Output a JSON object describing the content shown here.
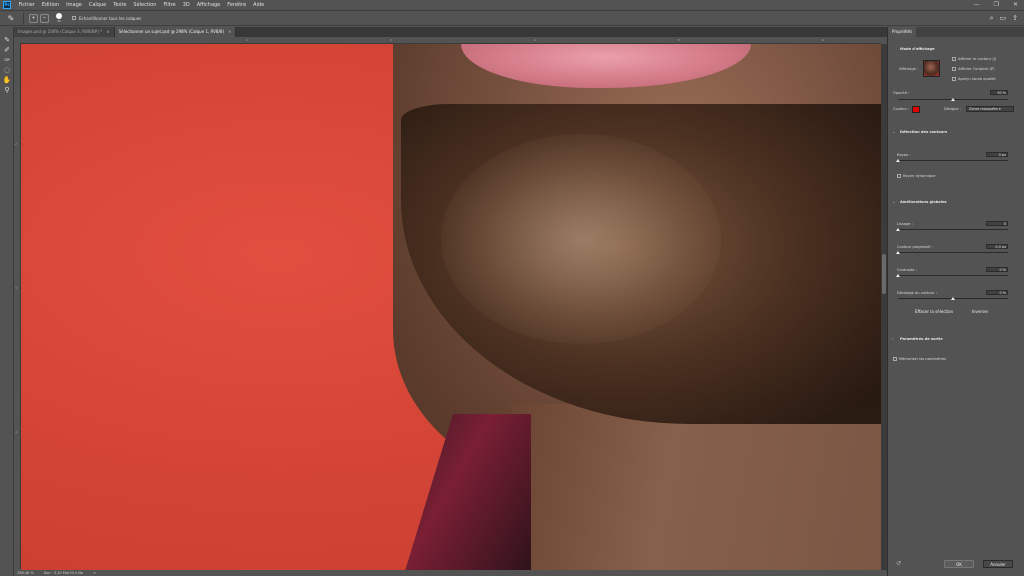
{
  "app": {
    "logo": "Ps"
  },
  "menu": [
    "Fichier",
    "Edition",
    "Image",
    "Calque",
    "Texte",
    "Sélection",
    "Filtre",
    "3D",
    "Affichage",
    "Fenêtre",
    "Aide"
  ],
  "window_controls": {
    "minimize": "—",
    "maximize": "❐",
    "close": "✕"
  },
  "options": {
    "brush_size": "30",
    "sample_all_layers": "Echantillonner tous les calques",
    "right_icons": [
      "search-icon",
      "workspace-icon",
      "share-icon"
    ]
  },
  "tabs": [
    {
      "label": "Images.psd @ 106% (Calque 3, RVB/8#) *",
      "close": "×",
      "active": false
    },
    {
      "label": "Sélectionner un sujet.psd @ 298% (Calque 1, RVB/8)",
      "close": "×",
      "active": true
    }
  ],
  "toolbar": [
    "brush-tool-icon",
    "quick-selection-icon",
    "refine-edge-brush-icon",
    "lasso-icon",
    "hand-icon",
    "zoom-icon"
  ],
  "ruler": {
    "top_ticks": [
      "2",
      "3",
      "4",
      "5",
      "6",
      "7"
    ],
    "left_ticks": [
      "2",
      "3",
      "4"
    ]
  },
  "status": {
    "zoom": "298,46 %",
    "doc": "Doc : 3,10 Mo/19,4 Mo",
    "arrow": ">"
  },
  "panel": {
    "tab": "Propriétés",
    "display": {
      "title": "Mode d'affichage",
      "affichage": "Affichage :",
      "show_edge": "Afficher le contour (J)",
      "show_original": "Afficher l'original (P)",
      "high_quality": "Aperçu haute qualité",
      "opacity_label": "Opacité :",
      "opacity_value": "50 %",
      "opacity_level": 0.5,
      "color_label": "Couleur :",
      "color_value": "#e00000",
      "indicates_label": "Désigne :",
      "indicates_value": "Zones masquées"
    },
    "edge_detection": {
      "title": "Détection des contours",
      "radius_label": "Rayon :",
      "radius_value": "0 px",
      "radius_level": 0,
      "smart_radius": "Rayon dynamique"
    },
    "global_refinements": {
      "title": "Améliorations globales",
      "smooth_label": "Lissage :",
      "smooth_value": "0",
      "smooth_level": 0,
      "feather_label": "Contour progressif :",
      "feather_value": "0,0 px",
      "feather_level": 0,
      "contrast_label": "Contraste :",
      "contrast_value": "0 %",
      "contrast_level": 0,
      "shift_label": "Décalage du contour :",
      "shift_value": "0 %",
      "shift_level": 0.5,
      "clear_button": "Effacer la sélection",
      "invert_button": "Inverser"
    },
    "output": {
      "title": "Paramètres de sortie"
    },
    "remember": "Mémoriser les paramètres",
    "ok": "OK",
    "cancel": "Annuler"
  }
}
